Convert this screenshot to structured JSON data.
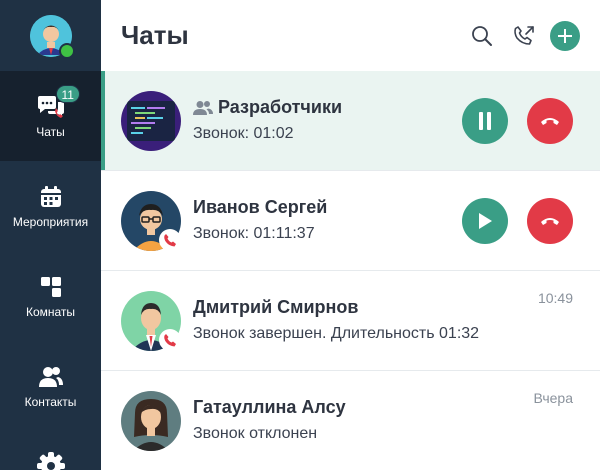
{
  "colors": {
    "sidebar": "#1f3144",
    "sidebar_active": "#16212e",
    "accent": "#3a9e86",
    "decline": "#e23a47",
    "online": "#3fc144",
    "active_row": "#eaf4f1"
  },
  "sidebar": {
    "items": [
      {
        "label": "Чаты",
        "icon": "chat-bubbles-icon",
        "badge": "11",
        "active": true
      },
      {
        "label": "Мероприятия",
        "icon": "calendar-icon"
      },
      {
        "label": "Комнаты",
        "icon": "rooms-icon"
      },
      {
        "label": "Контакты",
        "icon": "contacts-icon"
      }
    ]
  },
  "header": {
    "title": "Чаты",
    "icons": [
      "search-icon",
      "outgoing-call-icon",
      "plus-icon"
    ]
  },
  "chats": [
    {
      "name": "Разработчики",
      "subtitle": "Звонок: 01:02",
      "is_group": true,
      "state": "active-call"
    },
    {
      "name": "Иванов Сергей",
      "subtitle": "Звонок: 01:11:37",
      "state": "on-hold"
    },
    {
      "name": "Дмитрий Смирнов",
      "subtitle": "Звонок завершен. Длительность 01:32",
      "time": "10:49"
    },
    {
      "name": "Гатауллина Алсу",
      "subtitle": "Звонок отклонен",
      "time": "Вчера"
    }
  ]
}
